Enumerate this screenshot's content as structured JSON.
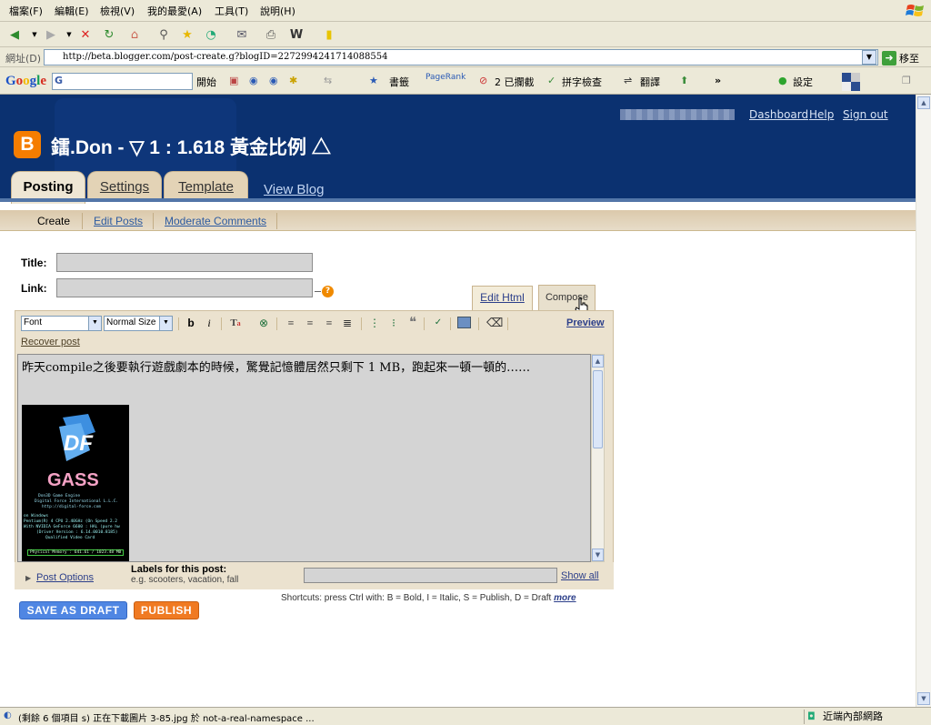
{
  "menu": [
    "檔案(F)",
    "編輯(E)",
    "檢視(V)",
    "我的最愛(A)",
    "工具(T)",
    "說明(H)"
  ],
  "address": {
    "label": "網址(D)",
    "url": "http://beta.blogger.com/post-create.g?blogID=2272994241714088554",
    "go_label": "移至"
  },
  "google_bar": {
    "logo": "Google",
    "search_prefix": "G",
    "items": [
      "開始",
      "書籤",
      "PageRank",
      "2 已攔截",
      "拼字檢查",
      "翻譯",
      "»",
      "設定"
    ]
  },
  "blogger": {
    "top_links": [
      "Dashboard",
      "Help",
      "Sign out"
    ],
    "logo_letter": "B",
    "blog_title": "鐳.Don - ▽ 1 : 1.618 黃金比例 △",
    "tabs": [
      "Posting",
      "Settings",
      "Template"
    ],
    "view_blog": "View Blog",
    "subnav": [
      "Create",
      "Edit Posts",
      "Moderate Comments"
    ]
  },
  "form": {
    "title_label": "Title:",
    "title_value": "",
    "link_label": "Link:",
    "link_value": "",
    "help_glyph": "?",
    "mode_tabs": [
      "Edit Html",
      "Compose"
    ]
  },
  "editor": {
    "font_select": "Font",
    "size_select": "Normal Size",
    "preview": "Preview",
    "recover": "Recover post",
    "content_text": "昨天compile之後要執行遊戲劇本的時候，驚覺記憶體居然只剩下 1 MB，跑起來一頓一頓的……",
    "image_brand": "GASS",
    "image_lines": [
      "Don3D Game Engine",
      "Digital Force International L.L.C.",
      "http://digital-force.com",
      "on Windows",
      "Pentium(R) 4 CPU 2.40GHz (On Speed 2.2",
      "With NVIDIA GeForce 6600 : HAL (pure hw",
      "(Driver Version : 6.14.0010.8185)",
      "Qualified Video Card",
      "Physical Memory : 641.61 / 1023.48 MB"
    ]
  },
  "labels": {
    "post_options": "Post Options",
    "title": "Labels for this post:",
    "example": "e.g. scooters, vacation, fall",
    "value": "",
    "show_all": "Show all"
  },
  "shortcuts": {
    "text": "Shortcuts: press Ctrl with: B = Bold, I = Italic, S = Publish, D = Draft",
    "more": "more"
  },
  "buttons": {
    "save_draft": "SAVE AS DRAFT",
    "publish": "PUBLISH"
  },
  "status": {
    "text": "(剩餘 6 個項目 s) 正在下載圖片 3-85.jpg 於 not-a-real-namespace ...",
    "zone": "近端內部網路"
  },
  "colors": {
    "header_bg": "#0b3170",
    "blogger_orange": "#f57d00",
    "save_draft_bg": "#4f86e3",
    "publish_bg": "#f07a22"
  }
}
